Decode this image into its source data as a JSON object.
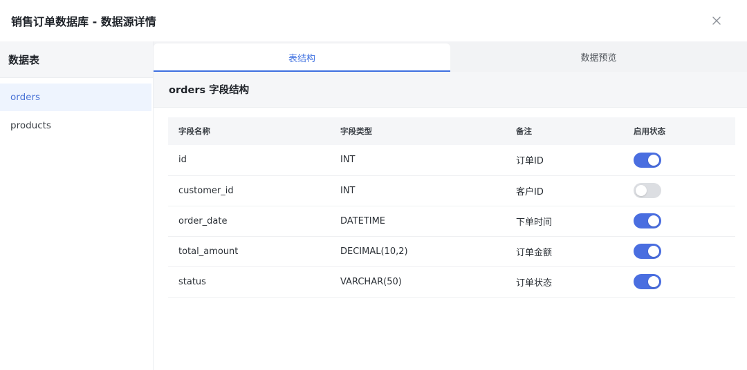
{
  "dialog": {
    "title": "销售订单数据库 - 数据源详情",
    "close_icon": "close-icon"
  },
  "sidebar": {
    "header": "数据表",
    "items": [
      {
        "label": "orders",
        "active": true
      },
      {
        "label": "products",
        "active": false
      }
    ]
  },
  "tabs": [
    {
      "label": "表结构",
      "active": true
    },
    {
      "label": "数据预览",
      "active": false
    }
  ],
  "section": {
    "title": "orders 字段结构"
  },
  "table": {
    "headers": [
      "字段名称",
      "字段类型",
      "备注",
      "启用状态"
    ],
    "rows": [
      {
        "name": "id",
        "type": "INT",
        "type_kind": "int",
        "note": "订单ID",
        "enabled": true
      },
      {
        "name": "customer_id",
        "type": "INT",
        "type_kind": "int",
        "note": "客户ID",
        "enabled": false
      },
      {
        "name": "order_date",
        "type": "DATETIME",
        "type_kind": "datetime",
        "note": "下单时间",
        "enabled": true
      },
      {
        "name": "total_amount",
        "type": "DECIMAL(10,2)",
        "type_kind": "decimal",
        "note": "订单金额",
        "enabled": true
      },
      {
        "name": "status",
        "type": "VARCHAR(50)",
        "type_kind": "varchar",
        "note": "订单状态",
        "enabled": true
      }
    ]
  },
  "colors": {
    "accent": "#3d6fe0",
    "toggle_on": "#4a6ee0",
    "toggle_off": "#dcdee2",
    "type_int": "#2fa84f",
    "type_datetime": "#e5484d",
    "type_decimal": "#9a6ee8",
    "type_varchar": "#3d6fe0"
  }
}
